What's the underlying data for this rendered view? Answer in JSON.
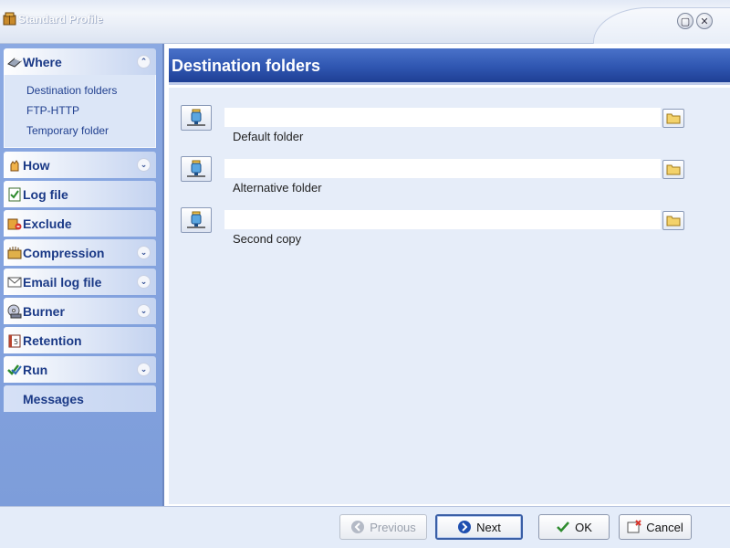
{
  "window": {
    "title": "Standard Profile",
    "icon": "profile-app-icon"
  },
  "sidebar": {
    "groups": [
      {
        "label": "Where",
        "icon": "where-icon",
        "expanded": true,
        "items": [
          {
            "label": "Destination folders"
          },
          {
            "label": "FTP-HTTP"
          },
          {
            "label": "Temporary folder"
          }
        ]
      },
      {
        "label": "How",
        "icon": "how-icon",
        "expanded": false,
        "has_chevron": true
      },
      {
        "label": "Log file",
        "icon": "log-file-icon",
        "has_chevron": false
      },
      {
        "label": "Exclude",
        "icon": "exclude-icon",
        "has_chevron": false
      },
      {
        "label": "Compression",
        "icon": "compression-icon",
        "has_chevron": true
      },
      {
        "label": "Email log file",
        "icon": "email-icon",
        "has_chevron": true
      },
      {
        "label": "Burner",
        "icon": "burner-icon",
        "has_chevron": true
      },
      {
        "label": "Retention",
        "icon": "retention-icon",
        "has_chevron": false
      },
      {
        "label": "Run",
        "icon": "run-icon",
        "has_chevron": true
      },
      {
        "label": "Messages",
        "icon": "",
        "has_chevron": false
      }
    ]
  },
  "main": {
    "title": "Destination folders",
    "folders": [
      {
        "label": "Default folder",
        "value": ""
      },
      {
        "label": "Alternative folder",
        "value": ""
      },
      {
        "label": "Second copy",
        "value": ""
      }
    ]
  },
  "buttons": {
    "previous": "Previous",
    "next": "Next",
    "ok": "OK",
    "cancel": "Cancel"
  },
  "colors": {
    "header_blue": "#2f56b1",
    "sidebar_blue": "#8ba9e2",
    "panel_bg": "#e6edf9"
  }
}
